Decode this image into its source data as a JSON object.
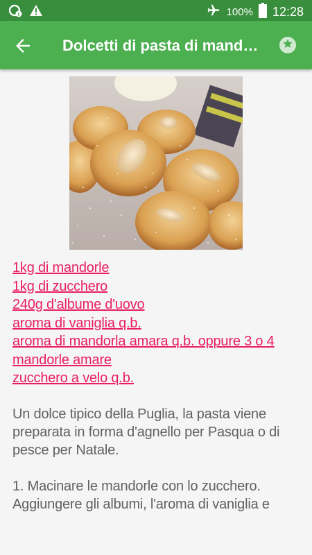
{
  "status_bar": {
    "battery": "100%",
    "time": "12:28",
    "icons": [
      "data-saver-icon",
      "warning-icon",
      "airplane-mode-icon",
      "battery-icon"
    ]
  },
  "app_bar": {
    "title": "Dolcetti di pasta di mandorle",
    "back_icon": "back-arrow-icon",
    "favorite_icon": "star-icon"
  },
  "recipe": {
    "photo": "photo of almond pastries dusted with powdered sugar",
    "ingredients": [
      "1kg di mandorle",
      "1kg di zucchero",
      "240g d'albume d'uovo",
      "aroma di vaniglia q.b.",
      "aroma di mandorla amara q.b. oppure 3 o 4 mandorle amare",
      "zucchero a velo q.b."
    ],
    "description": "Un dolce tipico della Puglia, la pasta viene preparata in forma d'agnello per Pasqua o di pesce per Natale.",
    "step_1": "1. Macinare le mandorle con lo zucchero. Aggiungere gli albumi, l'aroma di vaniglia e"
  },
  "colors": {
    "status_bar": "#388e3c",
    "app_bar": "#4caf50",
    "ingredient_link": "#e91e63",
    "body_text": "#616161",
    "background": "#f5f5f5"
  }
}
